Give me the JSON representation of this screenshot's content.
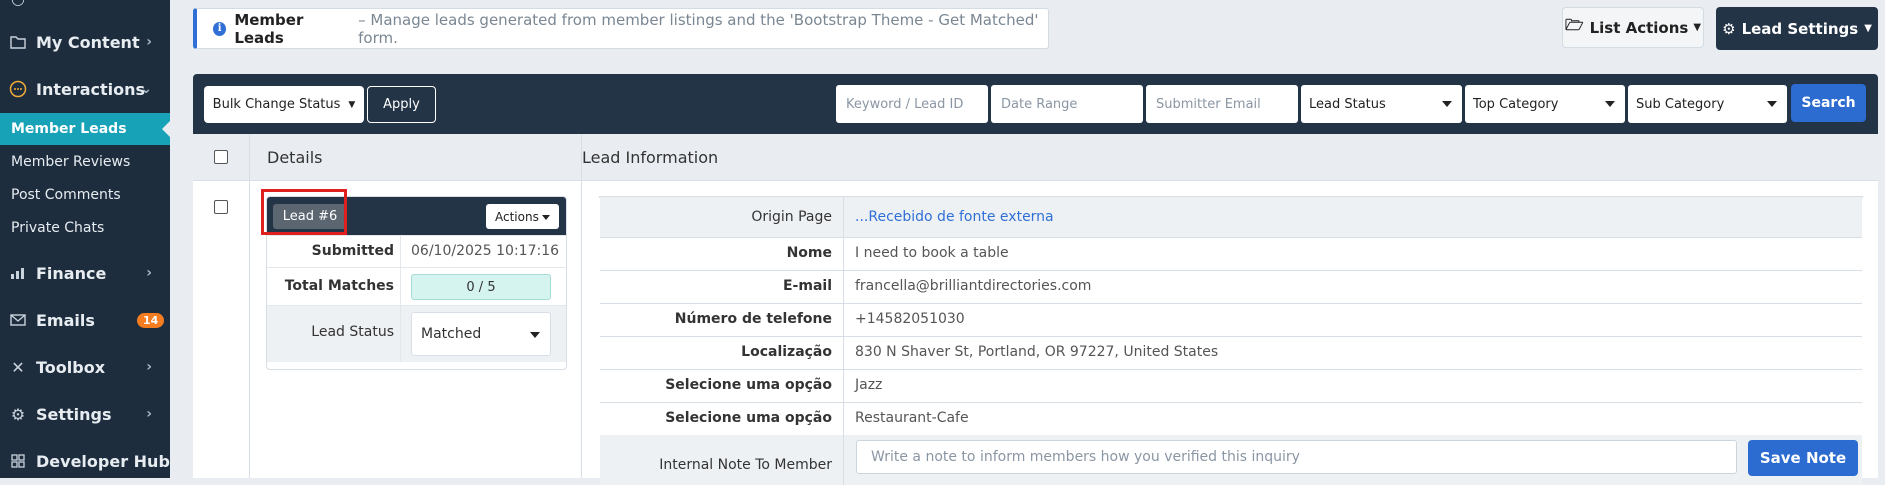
{
  "sidebar": {
    "items": [
      {
        "label": "My Content",
        "icon": "folder-icon"
      },
      {
        "label": "Interactions",
        "icon": "chat-icon"
      },
      {
        "label": "Member Leads"
      },
      {
        "label": "Member Reviews"
      },
      {
        "label": "Post Comments"
      },
      {
        "label": "Private Chats"
      },
      {
        "label": "Finance",
        "icon": "chart-icon"
      },
      {
        "label": "Emails",
        "icon": "mail-icon",
        "badge": "14"
      },
      {
        "label": "Toolbox",
        "icon": "tools-icon"
      },
      {
        "label": "Settings",
        "icon": "gear-icon"
      },
      {
        "label": "Developer Hub",
        "icon": "grid-icon"
      }
    ],
    "active_color": "#17a2b8"
  },
  "infobox": {
    "title": "Member Leads",
    "description": "– Manage leads generated from member listings and the 'Bootstrap Theme - Get Matched' form."
  },
  "header": {
    "list_actions": "List Actions",
    "lead_settings": "Lead Settings"
  },
  "toolbar": {
    "bulk_change_status": "Bulk Change Status",
    "apply": "Apply",
    "keyword_placeholder": "Keyword / Lead ID",
    "date_range_placeholder": "Date Range",
    "submitter_email_placeholder": "Submitter Email",
    "lead_status": "Lead Status",
    "top_category": "Top Category",
    "sub_category": "Sub Category",
    "search": "Search"
  },
  "table": {
    "columns": [
      "Details",
      "Lead Information"
    ],
    "lead": {
      "label": "Lead #6",
      "actions": "Actions",
      "submitted_label": "Submitted",
      "submitted_value": "06/10/2025 10:17:16",
      "matches_label": "Total Matches",
      "matches_value": "0 / 5",
      "matches_fraction": 0,
      "status_label": "Lead Status",
      "status_value": "Matched"
    },
    "info": [
      {
        "key": "Origin Page",
        "value": "...Recebido de fonte externa"
      },
      {
        "key": "Nome",
        "value": "I need to book a table"
      },
      {
        "key": "E-mail",
        "value": "francella@brilliantdirectories.com"
      },
      {
        "key": "Número de telefone",
        "value": "+14582051030"
      },
      {
        "key": "Localização",
        "value": "830 N Shaver St, Portland, OR 97227, United States"
      },
      {
        "key": "Selecione uma opção",
        "value": "Jazz"
      },
      {
        "key": "Selecione uma opção",
        "value": "Restaurant-Cafe"
      }
    ],
    "note": {
      "label": "Internal Note To Member",
      "placeholder": "Write a note to inform members how you verified this inquiry",
      "save": "Save Note"
    }
  },
  "colors": {
    "sidebar_bg": "#1e2d3d",
    "toolbar_bg": "#243447",
    "primary": "#2c6bd0",
    "badge": "#f57c1f",
    "highlight_box": "#e0201e"
  }
}
